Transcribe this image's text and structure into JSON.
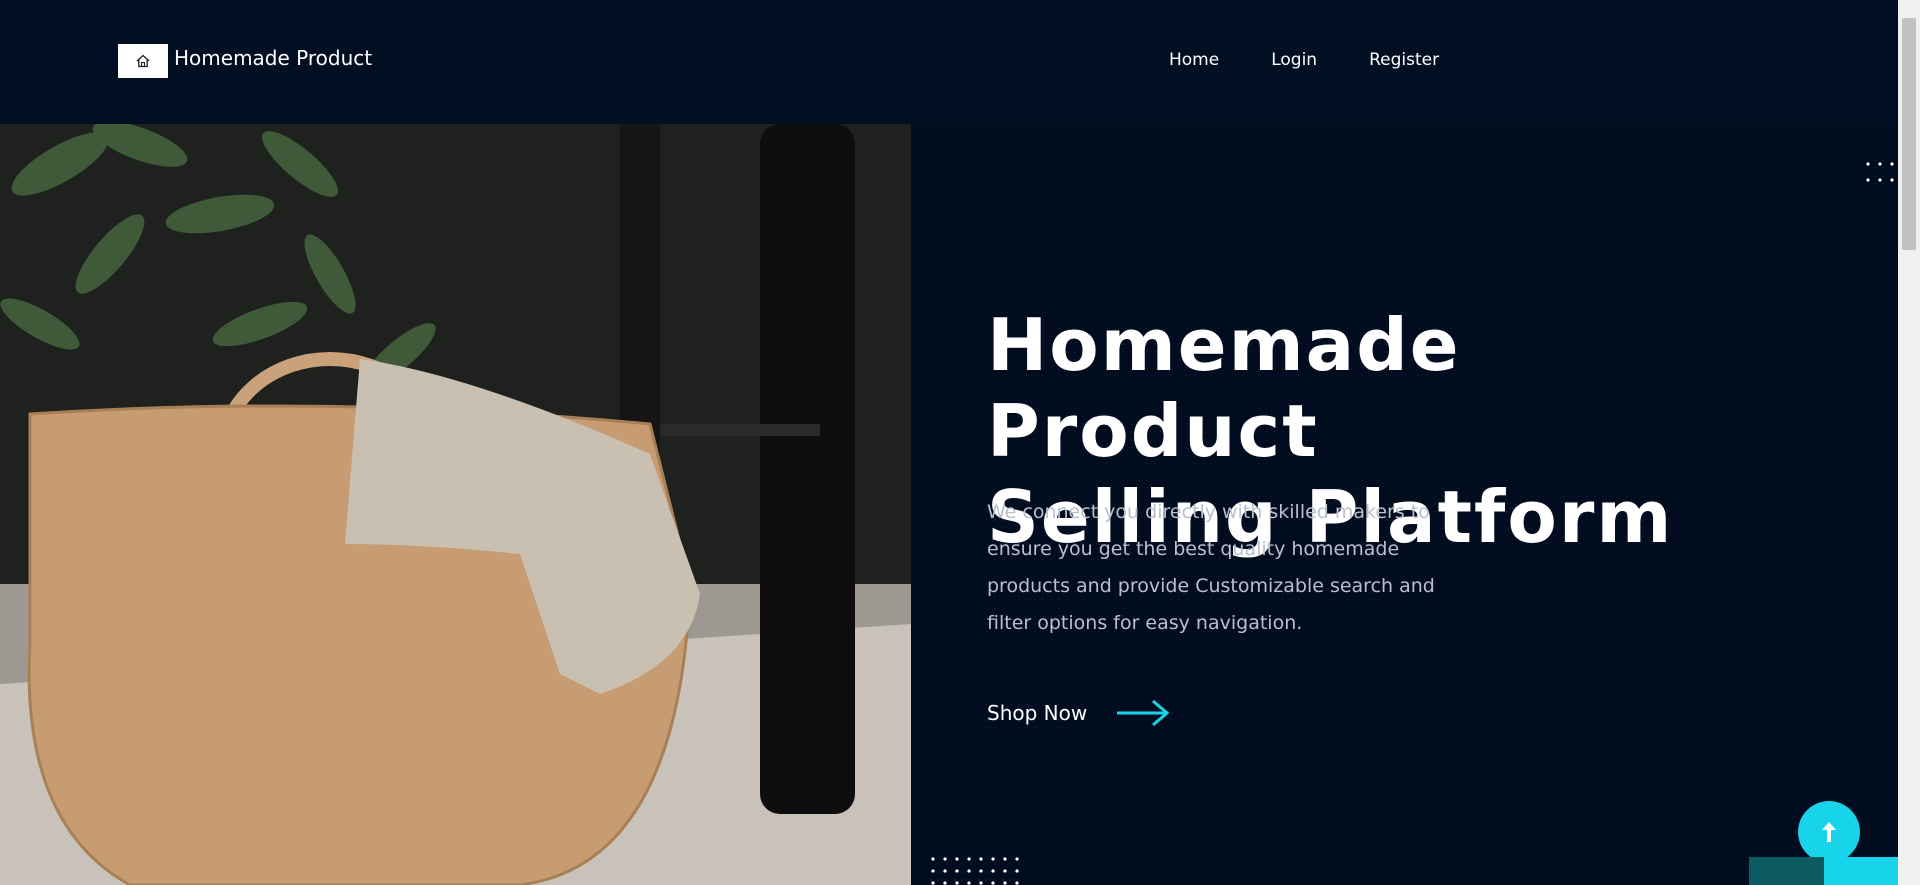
{
  "header": {
    "brand_name": "Homemade Product",
    "nav": [
      {
        "label": "Home"
      },
      {
        "label": "Login"
      },
      {
        "label": "Register"
      }
    ]
  },
  "hero": {
    "title_line1": "Homemade Product",
    "title_line2": "Selling Platform",
    "description": "We connect you directly with skilled makers to ensure you get the best quality homemade products and provide Customizable search and filter options for easy navigation.",
    "cta_label": "Shop Now"
  },
  "icons": {
    "brand": "home-icon",
    "cta": "arrow-right-icon",
    "back_to_top": "arrow-up-icon"
  },
  "colors": {
    "background": "#020c1f",
    "accent": "#18d4ea",
    "text": "#ffffff",
    "muted_text": "#b9c0cc"
  }
}
